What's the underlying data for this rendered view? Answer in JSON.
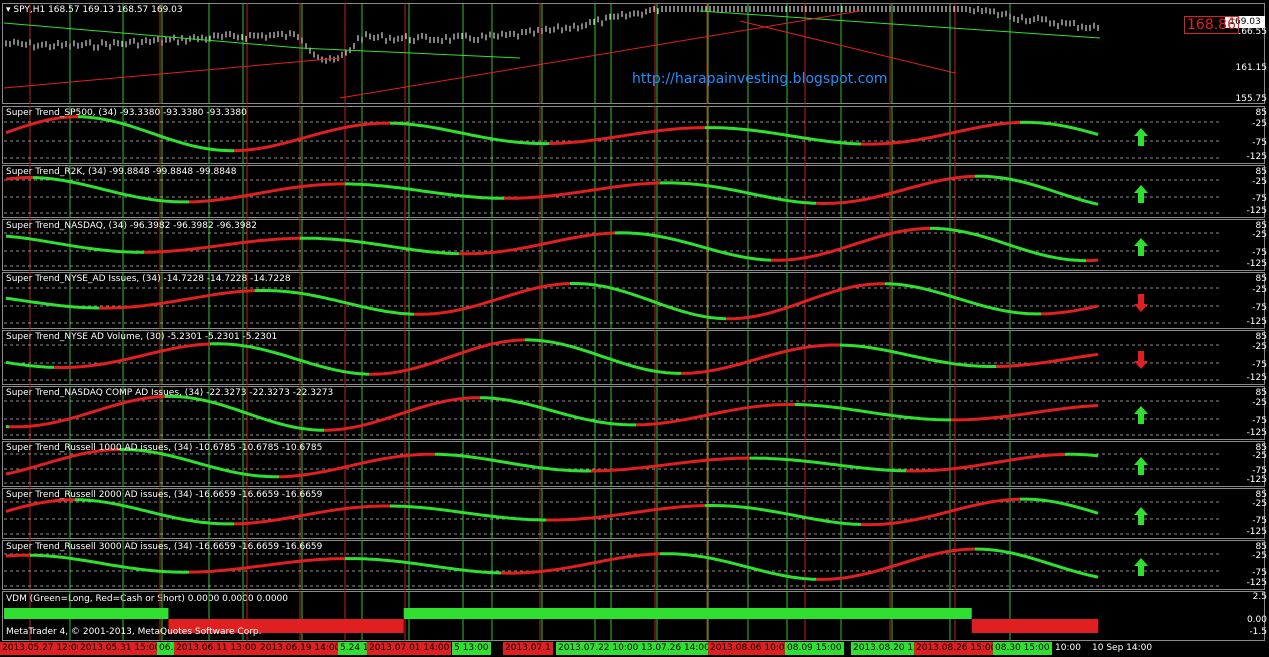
{
  "main": {
    "symbol_label": "SPY,H1",
    "ohlc": "168.57 169.13 168.57 169.03",
    "current_price_box": "169.03",
    "red_price_label": "168.86",
    "url": "http://harapainvesting.blogspot.com",
    "scale": [
      "166.55",
      "161.15",
      "155.75"
    ]
  },
  "indicators": [
    {
      "label": "Super Trend_SP500, (34)  -93.3380 -93.3380 -93.3380",
      "scale": [
        "85",
        "-25",
        "-75",
        "-125"
      ],
      "signal": "up"
    },
    {
      "label": "Super Trend_R2K, (34)  -99.8848 -99.8848 -99.8848",
      "scale": [
        "85",
        "-25",
        "-75",
        "-125"
      ],
      "signal": "up"
    },
    {
      "label": "Super Trend_NASDAQ, (34)  -96.3982 -96.3982 -96.3982",
      "scale": [
        "85",
        "-25",
        "-75",
        "-125"
      ],
      "signal": "up"
    },
    {
      "label": "Super Trend_NYSE_AD Issues, (34)  -14.7228 -14.7228 -14.7228",
      "scale": [
        "85",
        "-25",
        "-75",
        "-125"
      ],
      "signal": "down"
    },
    {
      "label": "Super Trend_NYSE AD Volume, (30)  -5.2301 -5.2301 -5.2301",
      "scale": [
        "85",
        "-25",
        "-75",
        "-125"
      ],
      "signal": "down"
    },
    {
      "label": "Super Trend_NASDAQ COMP AD Issues, (34)  -22.3273 -22.3273 -22.3273",
      "scale": [
        "85",
        "-25",
        "-75",
        "-125"
      ],
      "signal": "up"
    },
    {
      "label": "Super Trend_Russell 1000 AD issues, (34)  -10.6785 -10.6785 -10.6785",
      "scale": [
        "85",
        "-25",
        "-75",
        "-125"
      ],
      "signal": "up"
    },
    {
      "label": "Super Trend_Russell 2000 AD issues, (34)  -16.6659 -16.6659 -16.6659",
      "scale": [
        "85",
        "-25",
        "-75",
        "-125"
      ],
      "signal": "up"
    },
    {
      "label": "Super Trend_Russell 3000 AD issues, (34)  -16.6659 -16.6659 -16.6659",
      "scale": [
        "85",
        "-25",
        "-75",
        "-125"
      ],
      "signal": "up"
    }
  ],
  "vdm": {
    "label": "VDM (Green=Long, Red=Cash or Short) 0.0000 0.0000 0.0000",
    "scale": [
      "2.5",
      "0.00",
      "-1.5"
    ],
    "segments": [
      {
        "state": "long",
        "from": 0.0,
        "to": 0.13
      },
      {
        "state": "short",
        "from": 0.13,
        "to": 0.316
      },
      {
        "state": "long",
        "from": 0.316,
        "to": 0.765
      },
      {
        "state": "short",
        "from": 0.765,
        "to": 0.865
      }
    ]
  },
  "copyright": "MetaTrader 4, © 2001-2013, MetaQuotes Software Corp.",
  "time_axis": [
    {
      "text": "2013.05.27 12:00",
      "color": "#e02020"
    },
    {
      "text": "2013.05.31 15:00",
      "color": "#e02020"
    },
    {
      "text": "06.",
      "color": "#30e030"
    },
    {
      "text": "2013.06.11 13:00",
      "color": "#e02020"
    },
    {
      "text": "2013.06.19 14:00",
      "color": "#e02020"
    },
    {
      "text": "5.24 18:",
      "color": "#30e030"
    },
    {
      "text": "2013.07.01 14:00",
      "color": "#e02020"
    },
    {
      "text": "5 13:00",
      "color": "#30e030"
    },
    {
      "text": "2013.07.1",
      "color": "#e02020"
    },
    {
      "text": "2013.07.22 10:00",
      "color": "#30e030"
    },
    {
      "text": "13.07.26 14:00",
      "color": "#30e030"
    },
    {
      "text": "2013.08.06 10:00",
      "color": "#e02020"
    },
    {
      "text": "08.09 15:00",
      "color": "#30e030"
    },
    {
      "text": "2013.08.20 12:",
      "color": "#30e030"
    },
    {
      "text": "2013.08.26 15:00",
      "color": "#e02020"
    },
    {
      "text": "08.30 15:00",
      "color": "#30e030"
    },
    {
      "text": "10:00",
      "color": "#000000"
    },
    {
      "text": "10 Sep 14:00",
      "color": "#000000"
    }
  ],
  "colors": {
    "bull": "#30e030",
    "bear": "#e02020",
    "signal_yellow": "#f0f000",
    "grid_green": "#30c030",
    "grid_red": "#c02020"
  }
}
